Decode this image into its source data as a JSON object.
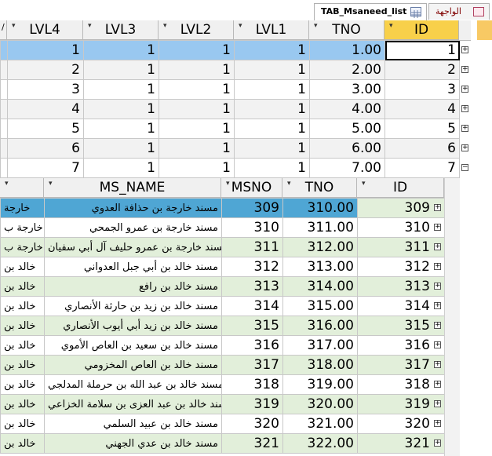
{
  "tabs": [
    {
      "label": "TAB_Msaneed_list",
      "icon": "table-icon",
      "active": true
    },
    {
      "label": "الواجهة",
      "icon": "form-icon",
      "active": false
    }
  ],
  "outer": {
    "columns": [
      "LVL4",
      "LVL3",
      "LVL2",
      "LVL1",
      "TNO",
      "ID"
    ],
    "rows": [
      [
        "1",
        "1",
        "1",
        "1",
        "1.00",
        "1"
      ],
      [
        "2",
        "1",
        "1",
        "1",
        "2.00",
        "2"
      ],
      [
        "3",
        "1",
        "1",
        "1",
        "3.00",
        "3"
      ],
      [
        "4",
        "1",
        "1",
        "1",
        "4.00",
        "4"
      ],
      [
        "5",
        "1",
        "1",
        "1",
        "5.00",
        "5"
      ],
      [
        "6",
        "1",
        "1",
        "1",
        "6.00",
        "6"
      ],
      [
        "7",
        "1",
        "1",
        "1",
        "7.00",
        "7"
      ]
    ]
  },
  "sub": {
    "columns": [
      "MS_NAME",
      "MSNO",
      "TNO",
      "ID"
    ],
    "rows": [
      {
        "left": "خارجة",
        "name": "مسند خارجة بن حذافة العدوي",
        "msno": "309",
        "tno": "310.00",
        "id": "309"
      },
      {
        "left": "خارجة ب",
        "name": "مسند خارجة بن عمرو الجمحي",
        "msno": "310",
        "tno": "311.00",
        "id": "310"
      },
      {
        "left": "خارجة ب",
        "name": "مسند خارجة بن عمرو حليف آل أبي سفيان",
        "msno": "311",
        "tno": "312.00",
        "id": "311"
      },
      {
        "left": "خالد بن",
        "name": "مسند خالد بن أبي جبل العدواني",
        "msno": "312",
        "tno": "313.00",
        "id": "312"
      },
      {
        "left": "خالد بن",
        "name": "مسند خالد بن رافع",
        "msno": "313",
        "tno": "314.00",
        "id": "313"
      },
      {
        "left": "خالد بن",
        "name": "مسند خالد بن زيد بن حارثة الأنصاري",
        "msno": "314",
        "tno": "315.00",
        "id": "314"
      },
      {
        "left": "خالد بن",
        "name": "مسند خالد بن زيد أبي أيوب الأنصاري",
        "msno": "315",
        "tno": "316.00",
        "id": "315"
      },
      {
        "left": "خالد بن",
        "name": "مسند خالد بن سعيد بن العاص الأموي",
        "msno": "316",
        "tno": "317.00",
        "id": "316"
      },
      {
        "left": "خالد بن",
        "name": "مسند خالد بن العاص المخزومي",
        "msno": "317",
        "tno": "318.00",
        "id": "317"
      },
      {
        "left": "خالد بن",
        "name": "مسند خالد بن عبد الله بن حرملة المدلجي",
        "msno": "318",
        "tno": "319.00",
        "id": "318"
      },
      {
        "left": "خالد بن",
        "name": "مسند خالد بن عبد العزى بن سلامة الخزاعي",
        "msno": "319",
        "tno": "320.00",
        "id": "319"
      },
      {
        "left": "خالد بن",
        "name": "مسند خالد بن عبيد السلمي",
        "msno": "320",
        "tno": "321.00",
        "id": "320"
      },
      {
        "left": "خالد بن",
        "name": "مسند خالد بن عدي الجهني",
        "msno": "321",
        "tno": "322.00",
        "id": "321"
      }
    ]
  },
  "colors": {
    "selected_row": "#99c8f0",
    "alt_row": "#f2f2f2",
    "sub_green": "#e2efda",
    "sub_selected": "#4fa6d4",
    "header_active": "#f8d04a"
  }
}
